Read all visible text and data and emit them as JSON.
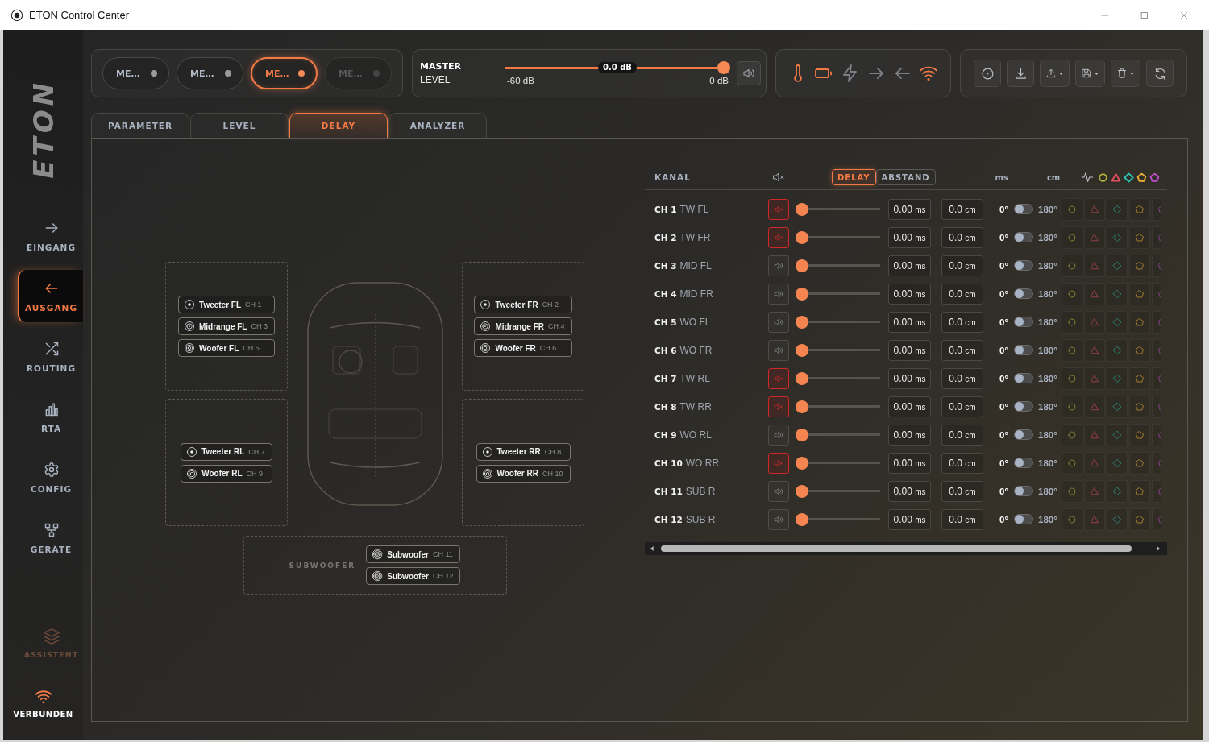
{
  "window": {
    "title": "ETON Control Center"
  },
  "sidebar": {
    "logo": "ETON",
    "items": [
      {
        "kind": "input",
        "label": "EINGANG",
        "selected": false
      },
      {
        "kind": "output",
        "label": "AUSGANG",
        "selected": true
      },
      {
        "kind": "routing",
        "label": "ROUTING",
        "selected": false
      },
      {
        "kind": "rta",
        "label": "RTA",
        "selected": false
      },
      {
        "kind": "config",
        "label": "CONFIG",
        "selected": false
      },
      {
        "kind": "devices",
        "label": "GERÄTE",
        "selected": false
      }
    ],
    "assistant": {
      "label": "ASSISTENT",
      "disabled": true
    },
    "connection": {
      "label": "VERBUNDEN"
    }
  },
  "memory_slots": [
    {
      "label": "ME…",
      "selected": false,
      "disabled": false
    },
    {
      "label": "ME…",
      "selected": false,
      "disabled": false
    },
    {
      "label": "ME…",
      "selected": true,
      "disabled": false
    },
    {
      "label": "ME…",
      "selected": false,
      "disabled": true
    }
  ],
  "master": {
    "title": "MASTER",
    "subtitle": "LEVEL",
    "value": "0.0 dB",
    "min_label": "-60 dB",
    "max_label": "0 dB",
    "level": 1
  },
  "status": [
    {
      "kind": "temperature",
      "active": true
    },
    {
      "kind": "battery",
      "active": true
    },
    {
      "kind": "power",
      "active": false
    },
    {
      "kind": "input",
      "active": false
    },
    {
      "kind": "output",
      "active": false
    },
    {
      "kind": "wifi",
      "active": true
    }
  ],
  "toolbar": [
    {
      "kind": "info",
      "menu": false
    },
    {
      "kind": "download",
      "menu": false
    },
    {
      "kind": "upload",
      "menu": true
    },
    {
      "kind": "save",
      "menu": true
    },
    {
      "kind": "delete",
      "menu": true
    },
    {
      "kind": "refresh",
      "menu": false
    }
  ],
  "tabs": [
    {
      "label": "PARAMETER",
      "selected": false
    },
    {
      "label": "LEVEL",
      "selected": false
    },
    {
      "label": "DELAY",
      "selected": true
    },
    {
      "label": "ANALYZER",
      "selected": false
    }
  ],
  "speaker_map": {
    "zones": [
      {
        "speakers": [
          {
            "kind": "tweeter",
            "name": "Tweeter FL",
            "channel": "CH 1"
          },
          {
            "kind": "midrange",
            "name": "Midrange FL",
            "channel": "CH 3"
          },
          {
            "kind": "woofer",
            "name": "Woofer FL",
            "channel": "CH 5"
          }
        ]
      },
      {
        "speakers": [
          {
            "kind": "tweeter",
            "name": "Tweeter FR",
            "channel": "CH 2"
          },
          {
            "kind": "midrange",
            "name": "Midrange FR",
            "channel": "CH 4"
          },
          {
            "kind": "woofer",
            "name": "Woofer FR",
            "channel": "CH 6"
          }
        ]
      },
      {
        "speakers": [
          {
            "kind": "tweeter",
            "name": "Tweeter RL",
            "channel": "CH 7"
          },
          {
            "kind": "woofer",
            "name": "Woofer RL",
            "channel": "CH 9"
          }
        ]
      },
      {
        "speakers": [
          {
            "kind": "tweeter",
            "name": "Tweeter RR",
            "channel": "CH 8"
          },
          {
            "kind": "woofer",
            "name": "Woofer RR",
            "channel": "CH 10"
          }
        ]
      }
    ],
    "subwoofer": {
      "label": "SUBWOOFER",
      "speakers": [
        {
          "kind": "subwoofer",
          "name": "Subwoofer",
          "channel": "CH 11"
        },
        {
          "kind": "subwoofer",
          "name": "Subwoofer",
          "channel": "CH 12"
        }
      ]
    }
  },
  "channel_table": {
    "header": {
      "channel": "KANAL",
      "modes": [
        {
          "label": "DELAY",
          "selected": true
        },
        {
          "label": "ABSTAND",
          "selected": false
        }
      ],
      "delay_unit": "ms",
      "distance_unit": "cm"
    },
    "groups": [
      {
        "kind": "circle",
        "color": "#b5b23c"
      },
      {
        "kind": "triangle",
        "color": "#e04f5f"
      },
      {
        "kind": "diamond",
        "color": "#2ec2b0"
      },
      {
        "kind": "pentagon",
        "color": "#f0b43a"
      },
      {
        "kind": "pentagon",
        "color": "#c04fd0"
      }
    ],
    "channels": [
      {
        "id": "CH 1",
        "name": "TW FL",
        "muted": true,
        "level": 0,
        "delay": "0.00",
        "delay_unit": "ms",
        "distance": "0.0",
        "distance_unit": "cm",
        "phase": [
          "0°",
          "180°"
        ],
        "phase_inverted": false
      },
      {
        "id": "CH 2",
        "name": "TW FR",
        "muted": true,
        "level": 0,
        "delay": "0.00",
        "delay_unit": "ms",
        "distance": "0.0",
        "distance_unit": "cm",
        "phase": [
          "0°",
          "180°"
        ],
        "phase_inverted": false
      },
      {
        "id": "CH 3",
        "name": "MID FL",
        "muted": false,
        "level": 0,
        "delay": "0.00",
        "delay_unit": "ms",
        "distance": "0.0",
        "distance_unit": "cm",
        "phase": [
          "0°",
          "180°"
        ],
        "phase_inverted": false
      },
      {
        "id": "CH 4",
        "name": "MID FR",
        "muted": false,
        "level": 0,
        "delay": "0.00",
        "delay_unit": "ms",
        "distance": "0.0",
        "distance_unit": "cm",
        "phase": [
          "0°",
          "180°"
        ],
        "phase_inverted": false
      },
      {
        "id": "CH 5",
        "name": "WO FL",
        "muted": false,
        "level": 0,
        "delay": "0.00",
        "delay_unit": "ms",
        "distance": "0.0",
        "distance_unit": "cm",
        "phase": [
          "0°",
          "180°"
        ],
        "phase_inverted": false
      },
      {
        "id": "CH 6",
        "name": "WO FR",
        "muted": false,
        "level": 0,
        "delay": "0.00",
        "delay_unit": "ms",
        "distance": "0.0",
        "distance_unit": "cm",
        "phase": [
          "0°",
          "180°"
        ],
        "phase_inverted": false
      },
      {
        "id": "CH 7",
        "name": "TW RL",
        "muted": true,
        "level": 0,
        "delay": "0.00",
        "delay_unit": "ms",
        "distance": "0.0",
        "distance_unit": "cm",
        "phase": [
          "0°",
          "180°"
        ],
        "phase_inverted": false
      },
      {
        "id": "CH 8",
        "name": "TW RR",
        "muted": true,
        "level": 0,
        "delay": "0.00",
        "delay_unit": "ms",
        "distance": "0.0",
        "distance_unit": "cm",
        "phase": [
          "0°",
          "180°"
        ],
        "phase_inverted": false
      },
      {
        "id": "CH 9",
        "name": "WO RL",
        "muted": false,
        "level": 0,
        "delay": "0.00",
        "delay_unit": "ms",
        "distance": "0.0",
        "distance_unit": "cm",
        "phase": [
          "0°",
          "180°"
        ],
        "phase_inverted": false
      },
      {
        "id": "CH 10",
        "name": "WO RR",
        "muted": true,
        "level": 0,
        "delay": "0.00",
        "delay_unit": "ms",
        "distance": "0.0",
        "distance_unit": "cm",
        "phase": [
          "0°",
          "180°"
        ],
        "phase_inverted": false
      },
      {
        "id": "CH 11",
        "name": "SUB R",
        "muted": false,
        "level": 0,
        "delay": "0.00",
        "delay_unit": "ms",
        "distance": "0.0",
        "distance_unit": "cm",
        "phase": [
          "0°",
          "180°"
        ],
        "phase_inverted": false
      },
      {
        "id": "CH 12",
        "name": "SUB R",
        "muted": false,
        "level": 0,
        "delay": "0.00",
        "delay_unit": "ms",
        "distance": "0.0",
        "distance_unit": "cm",
        "phase": [
          "0°",
          "180°"
        ],
        "phase_inverted": false
      }
    ]
  }
}
